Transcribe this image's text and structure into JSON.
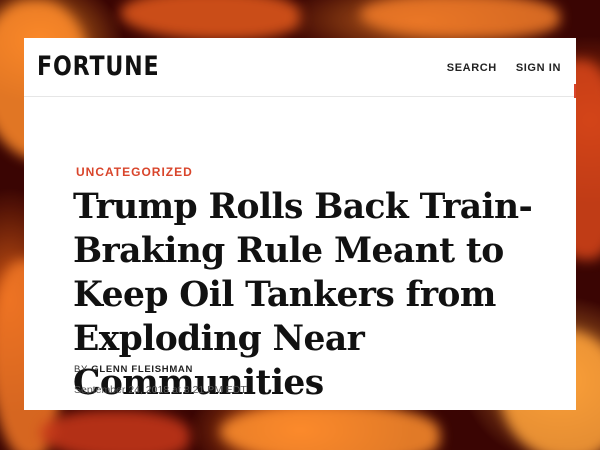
{
  "header": {
    "logo": "FORTUNE",
    "nav": {
      "search_label": "SEARCH",
      "signin_label": "SIGN IN"
    }
  },
  "article": {
    "category": "UNCATEGORIZED",
    "headline": "Trump Rolls Back Train-Braking Rule Meant to Keep Oil Tankers from Exploding Near Communities",
    "byline_prefix": "BY",
    "author": "GLENN FLEISHMAN",
    "date": "September 24, 2018 at 8:21 PM EDT"
  },
  "colors": {
    "accent": "#d9452b",
    "text": "#111111",
    "background_fire": "#7a0e08"
  }
}
